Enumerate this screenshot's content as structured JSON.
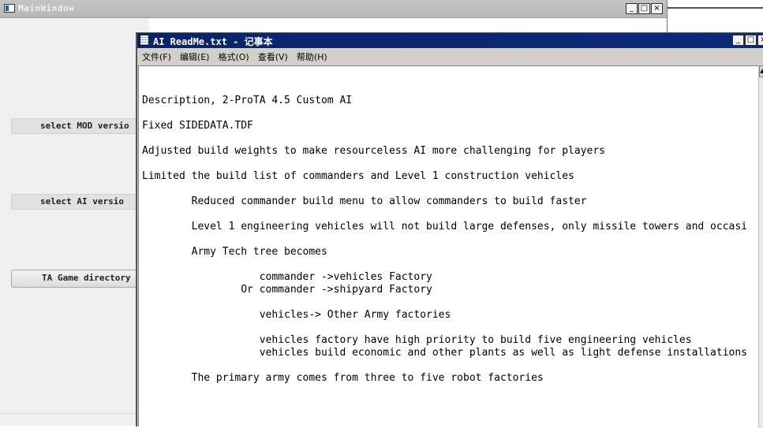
{
  "main_window": {
    "title": "MainWindow",
    "buttons": {
      "select_mod": "select MOD versio",
      "select_ai": "select AI versio",
      "ta_game_directory": "TA Game directory"
    }
  },
  "notepad": {
    "title": "AI ReadMe.txt - 记事本",
    "menu": [
      "文件(F)",
      "编辑(E)",
      "格式(O)",
      "查看(V)",
      "帮助(H)"
    ],
    "content_lines": [
      "",
      "",
      "Description, 2-ProTA 4.5 Custom AI",
      "",
      "Fixed SIDEDATA.TDF",
      "",
      "Adjusted build weights to make resourceless AI more challenging for players",
      "",
      "Limited the build list of commanders and Level 1 construction vehicles",
      "",
      "        Reduced commander build menu to allow commanders to build faster",
      "",
      "        Level 1 engineering vehicles will not build large defenses, only missile towers and occasi",
      "",
      "        Army Tech tree becomes",
      "",
      "                   commander ->vehicles Factory",
      "                Or commander ->shipyard Factory",
      "",
      "                   vehicles-> Other Army factories",
      "",
      "                   vehicles factory have high priority to build five engineering vehicles",
      "                   vehicles build economic and other plants as well as light defense installations",
      "",
      "        The primary army comes from three to five robot factories"
    ]
  },
  "caption_glyphs": {
    "minimize": "_",
    "maximize": "□",
    "close": "×"
  },
  "icons": {
    "main_window_icon": "app-window-icon",
    "notepad_icon": "notepad-icon"
  }
}
